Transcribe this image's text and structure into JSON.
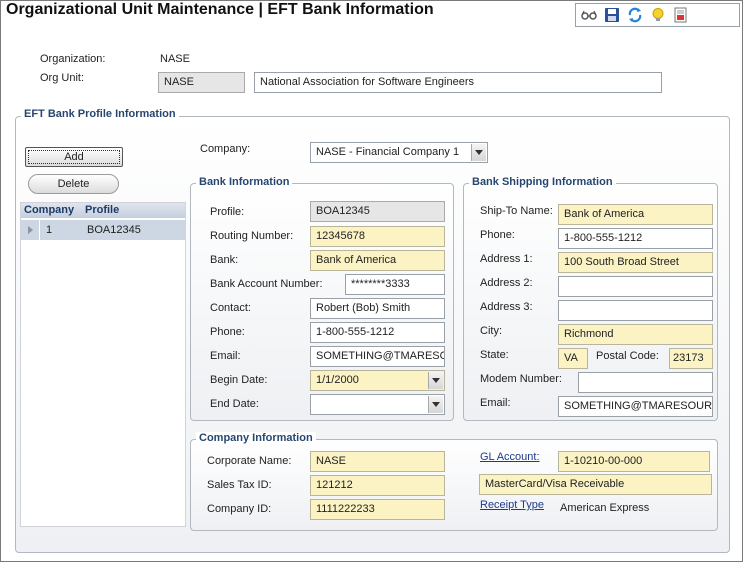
{
  "header": {
    "title": "Organizational Unit Maintenance | EFT Bank Information"
  },
  "toolbar": {
    "icons": [
      "glasses-icon",
      "save-icon",
      "refresh-icon",
      "lightbulb-icon",
      "report-icon"
    ]
  },
  "org": {
    "organization_label": "Organization:",
    "organization_value": "NASE",
    "org_unit_label": "Org Unit:",
    "org_unit_code": "NASE",
    "org_unit_name": "National Association for Software Engineers"
  },
  "eft_section": {
    "title": "EFT Bank Profile Information"
  },
  "actions": {
    "add_label": "Add",
    "delete_label": "Delete"
  },
  "profile_grid": {
    "columns": [
      "Company",
      "Profile"
    ],
    "rows": [
      {
        "company": "1",
        "profile": "BOA12345"
      }
    ]
  },
  "company_select": {
    "label": "Company:",
    "value": "NASE - Financial Company 1"
  },
  "bank_info": {
    "title": "Bank Information",
    "profile_label": "Profile:",
    "profile_value": "BOA12345",
    "routing_label": "Routing Number:",
    "routing_value": "12345678",
    "bank_label": "Bank:",
    "bank_value": "Bank of America",
    "account_label": "Bank Account Number:",
    "account_value": "********3333",
    "contact_label": "Contact:",
    "contact_value": "Robert (Bob) Smith",
    "phone_label": "Phone:",
    "phone_value": "1-800-555-1212",
    "email_label": "Email:",
    "email_value": "SOMETHING@TMARESO",
    "begin_label": "Begin Date:",
    "begin_value": "1/1/2000",
    "end_label": "End Date:",
    "end_value": ""
  },
  "shipping_info": {
    "title": "Bank Shipping Information",
    "shipto_label": "Ship-To Name:",
    "shipto_value": "Bank of America",
    "phone_label": "Phone:",
    "phone_value": "1-800-555-1212",
    "addr1_label": "Address 1:",
    "addr1_value": "100 South Broad Street",
    "addr2_label": "Address 2:",
    "addr2_value": "",
    "addr3_label": "Address 3:",
    "addr3_value": "",
    "city_label": "City:",
    "city_value": "Richmond",
    "state_label": "State:",
    "state_value": "VA",
    "postal_label": "Postal Code:",
    "postal_value": "23173",
    "modem_label": "Modem Number:",
    "modem_value": "",
    "email_label": "Email:",
    "email_value": "SOMETHING@TMARESOURC"
  },
  "company_info": {
    "title": "Company Information",
    "corp_label": "Corporate Name:",
    "corp_value": "NASE",
    "tax_label": "Sales Tax ID:",
    "tax_value": "121212",
    "id_label": "Company ID:",
    "id_value": "1111222233",
    "gl_label": "GL Account:",
    "gl_value": "1-10210-00-000",
    "gl_desc": "MasterCard/Visa Receivable",
    "receipt_label": "Receipt Type",
    "receipt_value": "American Express"
  },
  "colors": {
    "title_blue": "#27466f",
    "field_yellow": "#fbf3c4",
    "link_blue": "#1e3b8c"
  }
}
